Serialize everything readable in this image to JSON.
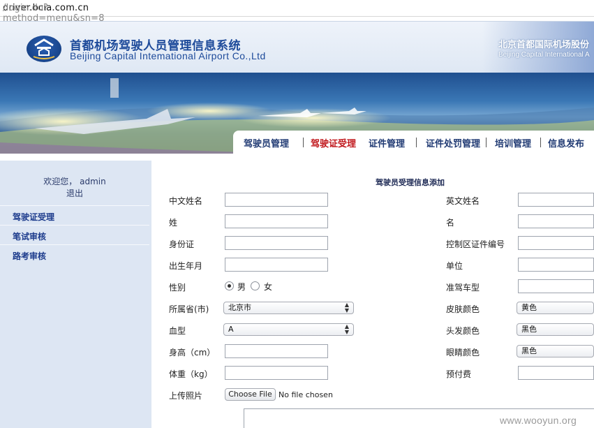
{
  "address_bar": {
    "host": "driver.bcia.com.cn",
    "path": "/login.do?method=menu&sn=8"
  },
  "header": {
    "title_cn": "首都机场驾驶人员管理信息系统",
    "title_en": "Beijing Capital Intemational Airport Co.,Ltd",
    "right_cn": "北京首都国际机场股份",
    "right_en": "Beijing Capital International A"
  },
  "nav": {
    "items": [
      {
        "label": "驾驶员管理",
        "active": false
      },
      {
        "label": "驾驶证受理",
        "active": true
      },
      {
        "label": "证件管理",
        "active": false
      },
      {
        "label": "证件处罚管理",
        "active": false
      },
      {
        "label": "培训管理",
        "active": false
      },
      {
        "label": "信息发布",
        "active": false
      }
    ]
  },
  "sidebar": {
    "welcome": "欢迎您， admin",
    "logout": "退出",
    "links": [
      "驾驶证受理",
      "笔试审核",
      "路考审核"
    ]
  },
  "form": {
    "title": "驾驶员受理信息添加",
    "left": {
      "chinese_name": "中文姓名",
      "surname": "姓",
      "id_card": "身份证",
      "birth": "出生年月",
      "gender": "性别",
      "gender_male": "男",
      "gender_female": "女",
      "gender_selected": "男",
      "province": "所属省(市)",
      "province_value": "北京市",
      "blood": "血型",
      "blood_value": "A",
      "height": "身高（cm）",
      "weight": "体重（kg）",
      "photo": "上传照片",
      "file_button": "Choose File",
      "file_status": "No file chosen"
    },
    "right": {
      "english_name": "英文姓名",
      "given_name": "名",
      "control_id": "控制区证件编号",
      "unit": "单位",
      "vehicle_type": "准驾车型",
      "skin_color": "皮肤颜色",
      "skin_value": "黄色",
      "hair_color": "头发颜色",
      "hair_value": "黑色",
      "eye_color": "眼睛颜色",
      "eye_value": "黑色",
      "prepaid_fee": "预付费"
    }
  },
  "watermark": "www.wooyun.org"
}
